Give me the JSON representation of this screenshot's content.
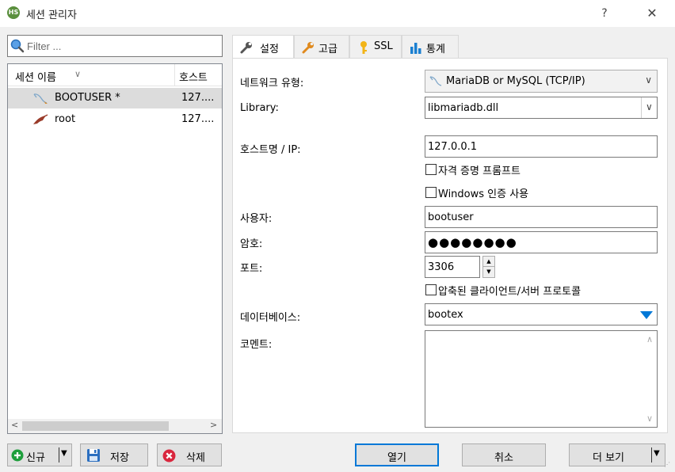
{
  "window": {
    "title": "세션 관리자",
    "app_badge": "HS",
    "help_label": "?",
    "close_label": "✕"
  },
  "left": {
    "filter_placeholder": "Filter ...",
    "columns": {
      "name": "세션 이름",
      "host": "호스트"
    },
    "sessions": [
      {
        "name": "BOOTUSER *",
        "host": "127....",
        "icon": "mariadb-icon"
      },
      {
        "name": "root",
        "host": "127....",
        "icon": "mariadb-icon"
      }
    ]
  },
  "tabs": [
    {
      "label": "설정",
      "icon": "wrench-icon",
      "active": true
    },
    {
      "label": "고급",
      "icon": "wrench-icon",
      "active": false
    },
    {
      "label": "SSL",
      "icon": "key-icon",
      "active": false
    },
    {
      "label": "통계",
      "icon": "bar-chart-icon",
      "active": false
    }
  ],
  "form": {
    "network_type_label": "네트워크 유형:",
    "network_type_value": "MariaDB or MySQL (TCP/IP)",
    "library_label": "Library:",
    "library_value": "libmariadb.dll",
    "host_label": "호스트명 / IP:",
    "host_value": "127.0.0.1",
    "prompt_credentials_label": "자격 증명 프롬프트",
    "prompt_credentials_checked": false,
    "windows_auth_label": "Windows 인증 사용",
    "windows_auth_checked": false,
    "user_label": "사용자:",
    "user_value": "bootuser",
    "password_label": "암호:",
    "password_value": "●●●●●●●●",
    "port_label": "포트:",
    "port_value": "3306",
    "compressed_label": "압축된 클라이언트/서버 프로토콜",
    "compressed_checked": false,
    "database_label": "데이터베이스:",
    "database_value": "bootex",
    "comment_label": "코멘트:",
    "comment_value": ""
  },
  "buttons": {
    "new_label": "신규",
    "save_label": "저장",
    "delete_label": "삭제",
    "open_label": "열기",
    "cancel_label": "취소",
    "more_label": "더 보기"
  },
  "colors": {
    "accent": "#0078d7",
    "selected_row": "#dcdcdc",
    "new_icon": "#1e9e3c",
    "delete_icon": "#d9263d"
  }
}
